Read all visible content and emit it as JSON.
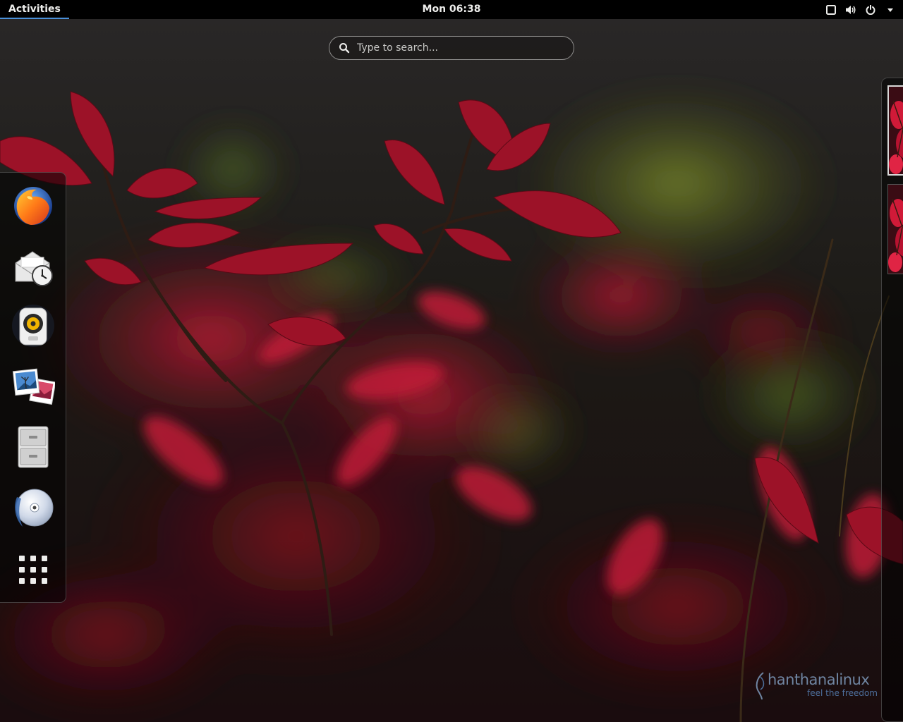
{
  "topbar": {
    "activities_label": "Activities",
    "clock": "Mon 06:38",
    "tray_icons": [
      "window-icon",
      "volume-icon",
      "power-icon",
      "menu-arrow-icon"
    ]
  },
  "search": {
    "placeholder": "Type to search...",
    "value": ""
  },
  "dash": {
    "apps": [
      {
        "icon": "firefox-icon",
        "name": "Firefox"
      },
      {
        "icon": "evolution-mail-icon",
        "name": "Evolution"
      },
      {
        "icon": "rhythmbox-icon",
        "name": "Rhythmbox"
      },
      {
        "icon": "shotwell-icon",
        "name": "Shotwell"
      },
      {
        "icon": "files-icon",
        "name": "Files"
      },
      {
        "icon": "brasero-icon",
        "name": "Brasero"
      },
      {
        "icon": "show-apps-icon",
        "name": "Show Applications"
      }
    ]
  },
  "workspaces": {
    "count": 2,
    "active": 1
  },
  "watermark": {
    "name": "hanthanalinux",
    "tagline": "feel the freedom"
  },
  "colors": {
    "topbar_bg": "#000000",
    "topbar_text": "#eeeeec",
    "activities_underline": "#4a90d9",
    "leaf_red": "#b0162e",
    "watermark": "#6f85a2"
  }
}
